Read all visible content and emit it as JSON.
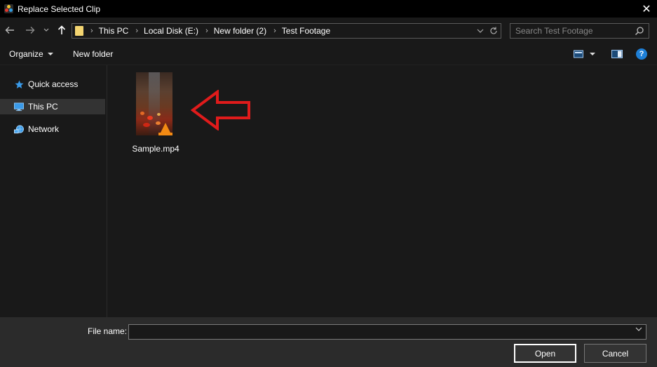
{
  "window": {
    "title": "Replace Selected Clip",
    "close_glyph": "✕"
  },
  "address": {
    "breadcrumbs": [
      "This PC",
      "Local Disk (E:)",
      "New folder (2)",
      "Test Footage"
    ]
  },
  "search": {
    "placeholder": "Search Test Footage"
  },
  "toolbar": {
    "organize_label": "Organize",
    "new_folder_label": "New folder",
    "help_glyph": "?"
  },
  "sidebar": {
    "items": [
      {
        "label": "Quick access",
        "icon": "star-icon",
        "selected": false
      },
      {
        "label": "This PC",
        "icon": "computer-icon",
        "selected": true
      },
      {
        "label": "Network",
        "icon": "network-icon",
        "selected": false
      }
    ]
  },
  "files": [
    {
      "name": "Sample.mp4",
      "type": "video",
      "icon": "vlc-cone-icon"
    }
  ],
  "footer": {
    "file_name_label": "File name:",
    "file_name_value": "",
    "open_label": "Open",
    "cancel_label": "Cancel"
  },
  "colors": {
    "accent_red_arrow": "#e01b1b",
    "help_blue": "#1e7fd6",
    "folder_yellow": "#f4d571"
  }
}
